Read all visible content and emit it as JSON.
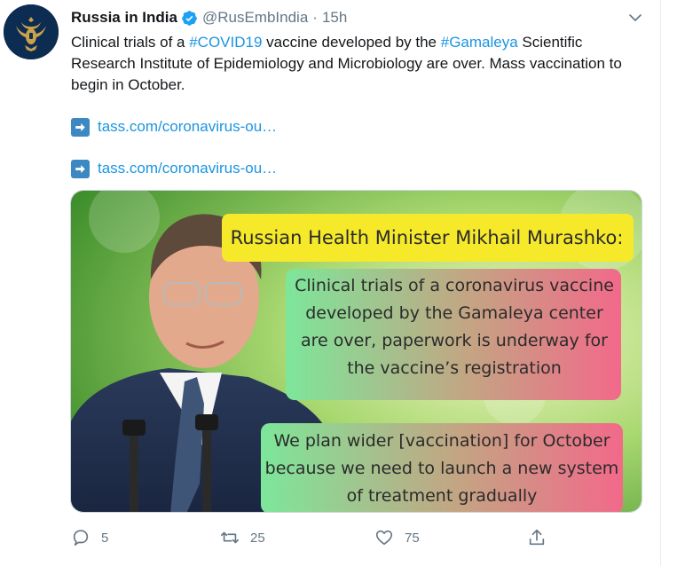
{
  "account": {
    "display_name": "Russia in India",
    "handle": "@RusEmbIndia",
    "separator": "·",
    "time": "15h"
  },
  "tweet": {
    "text_segments": [
      "Clinical trials of a ",
      "#COVID19",
      " vaccine developed by the ",
      "#Gamaleya",
      " Scientific Research Institute of Epidemiology and Microbiology are over. Mass vaccination to begin in October."
    ],
    "links": [
      {
        "text": "tass.com/coronavirus-ou…"
      },
      {
        "text": "tass.com/coronavirus-ou…"
      }
    ]
  },
  "media": {
    "title": "Russian Health Minister Mikhail Murashko:",
    "quote1": "Clinical trials of a coronavirus vaccine developed by the Gamaleya center are over, paperwork is underway for the vaccine’s registration",
    "quote2": "We plan wider [vaccination] for October because we need to launch a new system of treatment gradually"
  },
  "actions": {
    "reply_count": "5",
    "retweet_count": "25",
    "like_count": "75"
  },
  "colors": {
    "link": "#1b95e0",
    "muted": "#657786",
    "verified": "#1da1f2",
    "title_box": "#f5e92a",
    "avatar_bg": "#0d2c52"
  },
  "icons": [
    "avatar-emblem-icon",
    "verified-badge-icon",
    "chevron-down-icon",
    "right-arrow-emoji-icon",
    "reply-icon",
    "retweet-icon",
    "like-icon",
    "share-icon"
  ]
}
